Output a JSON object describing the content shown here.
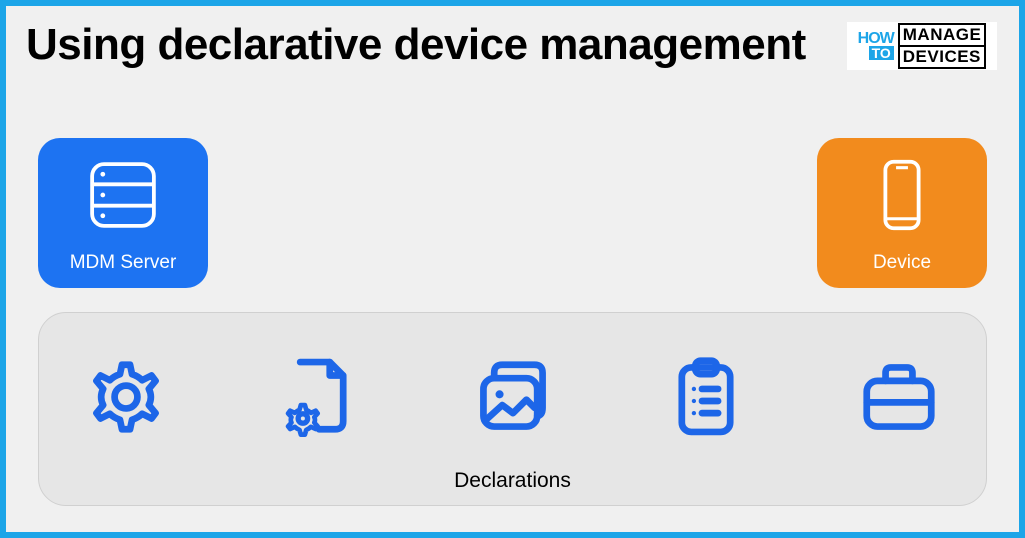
{
  "title": "Using declarative device management",
  "logo": {
    "how": "HOW",
    "to": "TO",
    "manage": "MANAGE",
    "devices": "DEVICES"
  },
  "cards": {
    "server": {
      "label": "MDM Server"
    },
    "device": {
      "label": "Device"
    }
  },
  "panel": {
    "label": "Declarations"
  },
  "colors": {
    "border": "#1ca5e8",
    "blue": "#1d73f2",
    "orange": "#f28b1d",
    "iconBlue": "#1d66e8"
  }
}
